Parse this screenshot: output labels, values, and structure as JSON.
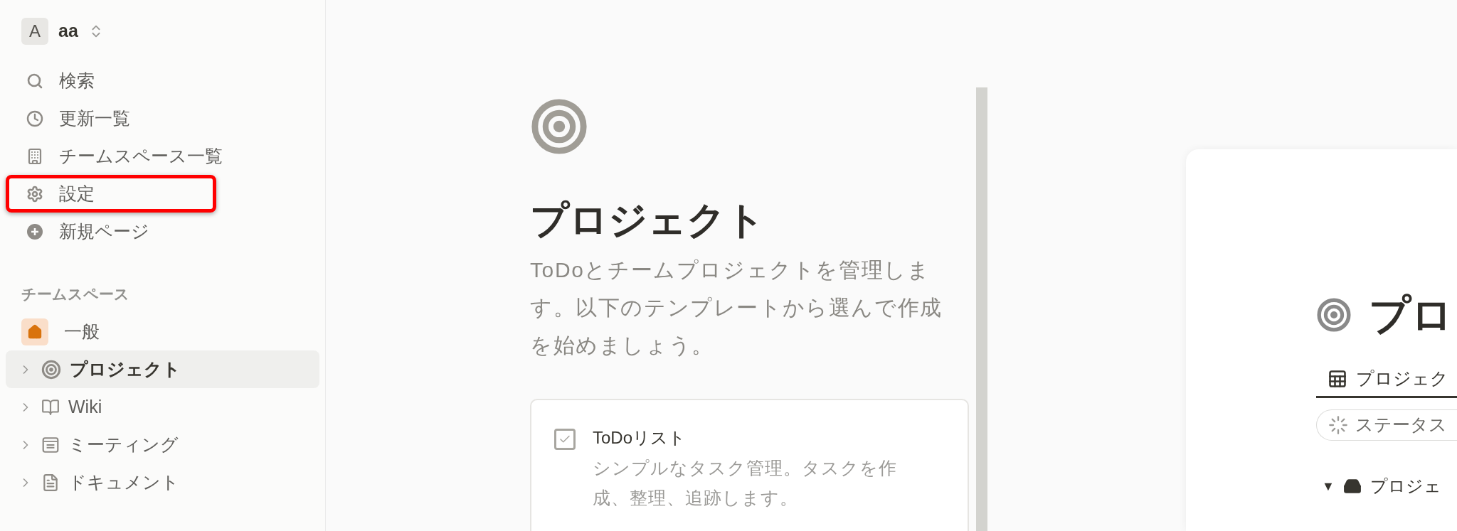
{
  "sidebar": {
    "workspace": {
      "avatar": "A",
      "name": "aa"
    },
    "nav": [
      {
        "kind": "search",
        "label": "検索",
        "highlighted": false
      },
      {
        "kind": "clock",
        "label": "更新一覧",
        "highlighted": false
      },
      {
        "kind": "building",
        "label": "チームスペース一覧",
        "highlighted": false
      },
      {
        "kind": "gear",
        "label": "設定",
        "highlighted": true
      },
      {
        "kind": "plus",
        "label": "新規ページ",
        "highlighted": false
      }
    ],
    "section_title": "チームスペース",
    "teamspaces": [
      {
        "kind": "home",
        "label": "一般",
        "expandable": false,
        "selected": false
      },
      {
        "kind": "target",
        "label": "プロジェクト",
        "expandable": true,
        "selected": true
      },
      {
        "kind": "book",
        "label": "Wiki",
        "expandable": true,
        "selected": false
      },
      {
        "kind": "notes",
        "label": "ミーティング",
        "expandable": true,
        "selected": false
      },
      {
        "kind": "document",
        "label": "ドキュメント",
        "expandable": true,
        "selected": false
      }
    ]
  },
  "template_panel": {
    "title": "プロジェクト",
    "description": "ToDoとチームプロジェクトを管理します。以下のテンプレートから選んで作成を始めましょう。",
    "templates": [
      {
        "title": "ToDoリスト",
        "description": "シンプルなタスク管理。タスクを作成、整理、追跡します。"
      }
    ]
  },
  "preview": {
    "title": "プロ",
    "tab": "プロジェク",
    "filter": "ステータス",
    "toggle": "▼",
    "group": "プロジェ"
  }
}
